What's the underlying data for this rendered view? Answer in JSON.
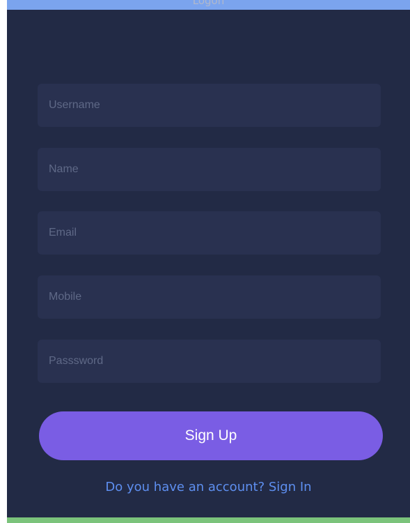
{
  "header": {
    "title": "Logon"
  },
  "form": {
    "fields": [
      {
        "placeholder": "Username",
        "value": ""
      },
      {
        "placeholder": "Name",
        "value": ""
      },
      {
        "placeholder": "Email",
        "value": ""
      },
      {
        "placeholder": "Mobile",
        "value": ""
      },
      {
        "placeholder": "Passsword",
        "value": ""
      }
    ],
    "submit_label": "Sign Up",
    "account_prompt": "Do you have an account?",
    "signin_label": "Sign In"
  },
  "colors": {
    "panel_background": "#222a45",
    "field_background": "#293150",
    "button": "#7a5de4",
    "link": "#5e8ff0",
    "top_bar": "#7ba4ee",
    "bottom_bar": "#7bc37b"
  }
}
